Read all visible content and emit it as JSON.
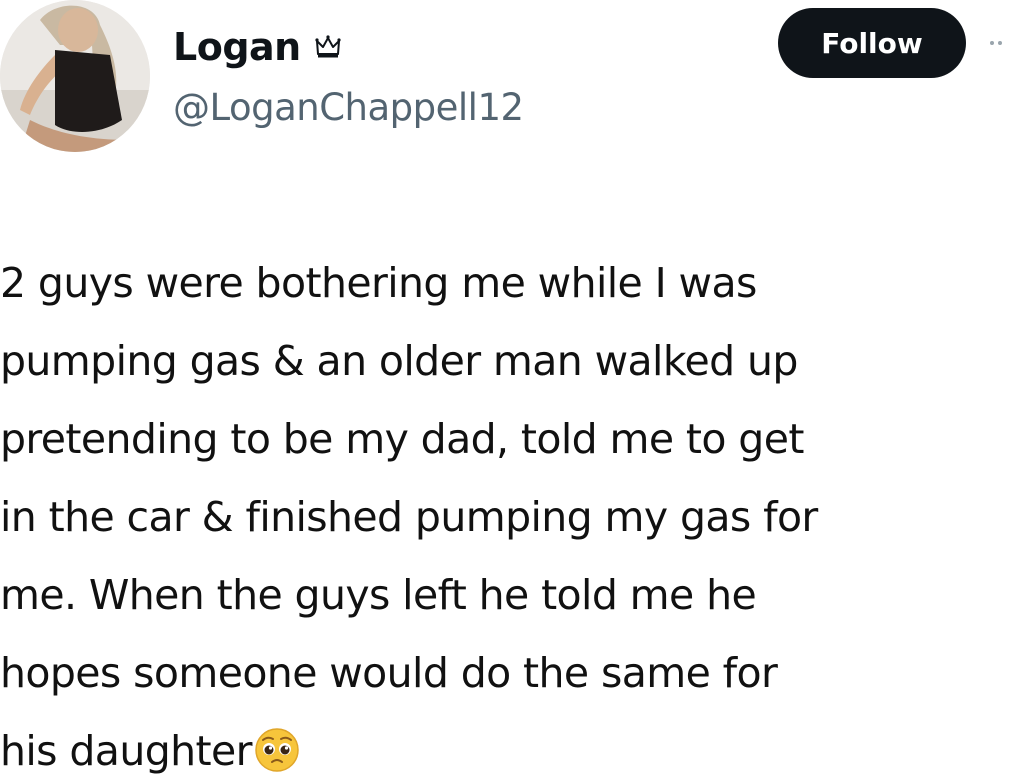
{
  "tweet": {
    "author": {
      "display_name": "Logan",
      "badge_icon": "crown-icon",
      "handle": "@LoganChappell12",
      "avatar_icon": "profile-photo"
    },
    "follow_label": "Follow",
    "text_lines": [
      "2 guys were bothering me while I was",
      "pumping gas & an older man walked up",
      "pretending to be my dad, told me to get",
      "in the car & finished pumping my gas for",
      "me. When the guys left he told me he",
      "hopes someone would do the same for",
      "his daughter"
    ],
    "trailing_emoji": "pleading-face-emoji"
  },
  "colors": {
    "background": "#ffffff",
    "text": "#0f1419",
    "handle": "#536471",
    "follow_button_bg": "#0f1419",
    "follow_button_text": "#ffffff"
  }
}
